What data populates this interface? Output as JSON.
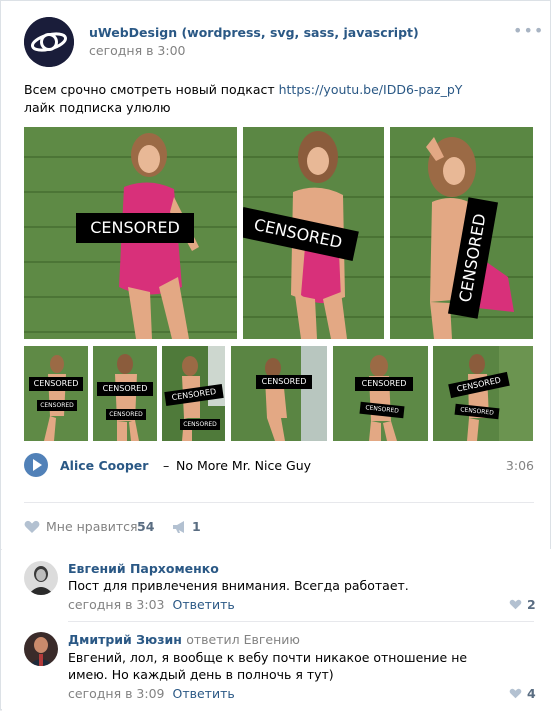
{
  "post": {
    "group_name": "uWebDesign (wordpress, svg, sass, javascript)",
    "date": "сегодня в 3:00",
    "more": "•••",
    "text_line1": "Всем срочно смотреть новый подкаст ",
    "link": "https://youtu.be/IDD6-paz_pY",
    "text_line2": "лайк подписка улюлю"
  },
  "photos": {
    "censor_label": "CENSORED",
    "count_top": 3,
    "count_bottom": 7
  },
  "audio": {
    "artist": "Alice Cooper",
    "separator": "–",
    "title": "No More Mr. Nice Guy",
    "duration": "3:06"
  },
  "actions": {
    "like_label": "Мне нравится",
    "like_count": "54",
    "share_count": "1"
  },
  "comments": [
    {
      "author": "Евгений Пархоменко",
      "replied_to": "",
      "text": "Пост для привлечения внимания. Всегда работает.",
      "date": "сегодня в 3:03",
      "reply_label": "Ответить",
      "likes": "2"
    },
    {
      "author": "Дмитрий Зюзин",
      "replied_to": "ответил Евгению",
      "text": "Евгений, лол, я вообще к вебу почти никакое отношение не имею. Но каждый день в полночь я тут)",
      "date": "сегодня в 3:09",
      "reply_label": "Ответить",
      "likes": "4"
    }
  ],
  "colors": {
    "link": "#2a5885",
    "muted": "#828282",
    "accent": "#5181b8",
    "wall_green": "#5f8a46",
    "dress_pink": "#d8307a"
  }
}
